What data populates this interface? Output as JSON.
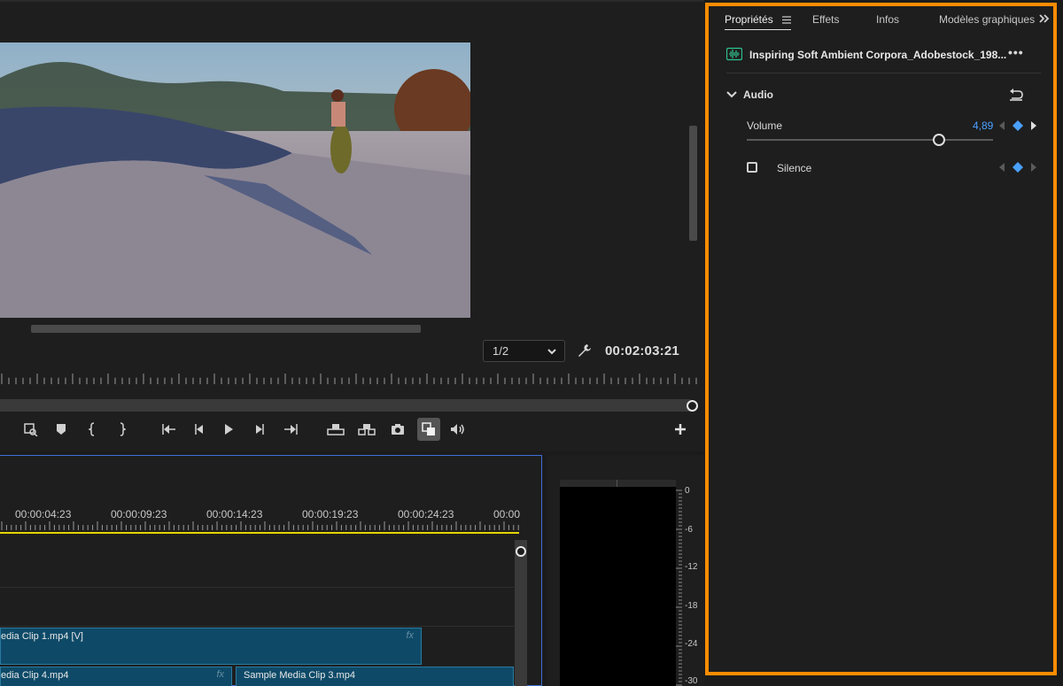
{
  "monitor": {
    "resolution": "1/2",
    "timecode": "00:02:03:21"
  },
  "timeline": {
    "timecodes": [
      "00:00:04:23",
      "00:00:09:23",
      "00:00:14:23",
      "00:00:19:23",
      "00:00:24:23",
      "00:00"
    ],
    "clips": {
      "clip1": "edia Clip 1.mp4 [V]",
      "clip4": "edia Clip 4.mp4",
      "clip3": "Sample Media Clip 3.mp4",
      "fx": "fx"
    }
  },
  "meter": {
    "labels": [
      "0",
      "-6",
      "-12",
      "-18",
      "-24",
      "-30"
    ]
  },
  "properties": {
    "tabs": [
      "Propriétés",
      "Effets",
      "Infos",
      "Modèles graphiques"
    ],
    "clip_name": "Inspiring Soft Ambient Corpora_Adobestock_198...",
    "section_title": "Audio",
    "volume_label": "Volume",
    "volume_value": "4,89",
    "volume_level": 0.78,
    "silence_label": "Silence"
  },
  "colors": {
    "accent_highlight": "#ff8c00",
    "value_blue": "#4aa0ff",
    "clip_fill": "#0e4a68",
    "playhead_yellow": "#e6d400"
  },
  "icons": [
    "waveform-icon",
    "more-icon",
    "chevron-down-icon",
    "reset-icon",
    "keyframe-icon",
    "wrench-icon",
    "menu-icon",
    "double-chevron-icon"
  ]
}
